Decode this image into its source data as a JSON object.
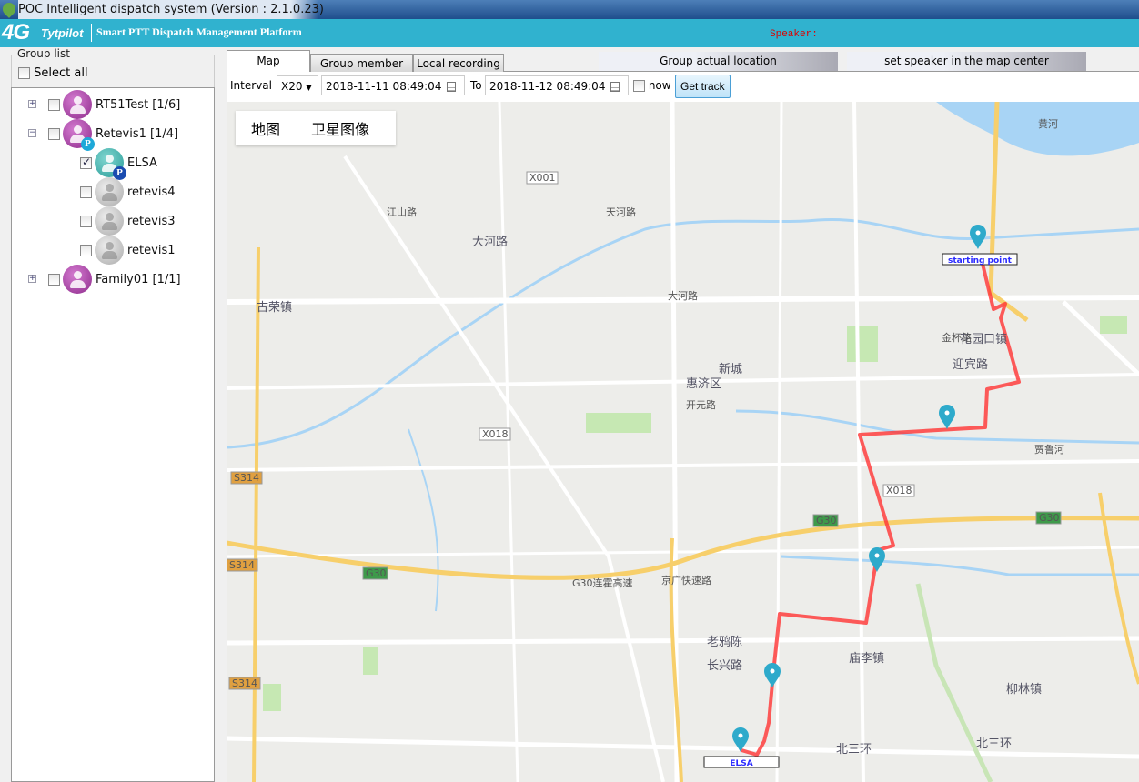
{
  "window": {
    "title": "POC Intelligent dispatch system (Version : 2.1.0.23)"
  },
  "brand": {
    "logo_main": "4G",
    "logo_sub": "Tytpilot",
    "subtitle": "Smart PTT Dispatch Management Platform",
    "speaker_label": "Speaker:"
  },
  "group_panel": {
    "title": "Group list",
    "select_all": "Select all",
    "nodes": [
      {
        "label": "RT51Test [1/6]",
        "type": "group",
        "expanded": false,
        "checked": false
      },
      {
        "label": "Retevis1 [1/4]",
        "type": "group",
        "expanded": true,
        "checked": false,
        "badge": "P"
      },
      {
        "label": "ELSA",
        "type": "member",
        "online": true,
        "checked": true,
        "badge": "P"
      },
      {
        "label": "retevis4",
        "type": "member",
        "online": false,
        "checked": false
      },
      {
        "label": "retevis3",
        "type": "member",
        "online": false,
        "checked": false
      },
      {
        "label": "retevis1",
        "type": "member",
        "online": false,
        "checked": false
      },
      {
        "label": "Family01 [1/1]",
        "type": "group",
        "expanded": false,
        "checked": false
      }
    ]
  },
  "tabs": [
    {
      "label": "Map",
      "active": true
    },
    {
      "label": "Group member"
    },
    {
      "label": "Local recording"
    }
  ],
  "header_buttons": {
    "group_location": "Group actual location",
    "set_speaker_center": "set speaker in the map center"
  },
  "toolbar": {
    "interval_label": "Interval",
    "interval_value": "X20",
    "from": "2018-11-11 08:49:04",
    "to_label": "To",
    "to": "2018-11-12 08:49:04",
    "now_label": "now",
    "now_checked": false,
    "get_track": "Get track"
  },
  "map": {
    "type_buttons": [
      "地图",
      "卫星图像"
    ],
    "markers": {
      "start": "starting point",
      "end": "ELSA"
    },
    "places": [
      "大河路",
      "古荣镇",
      "新城",
      "惠济区",
      "开元路",
      "花园口镇",
      "迎宾路",
      "老鸦陈",
      "长兴路",
      "庙李镇",
      "柳林镇",
      "北三环",
      "北三环",
      "贾鲁河",
      "黄河",
      "X001",
      "X018",
      "X018",
      "S314",
      "S314",
      "S314",
      "G30",
      "G30",
      "G30",
      "G30连霍高速",
      "京广快速路",
      "大河路",
      "江山路",
      "天河路",
      "金杯路"
    ],
    "colors": {
      "track": "#ff3333",
      "marker": "#2eaacb",
      "highway": "#f7cf6b",
      "water": "#a8d4f5"
    }
  }
}
